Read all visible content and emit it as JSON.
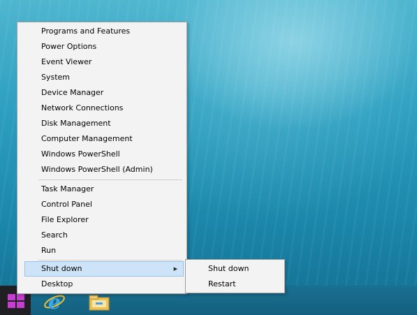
{
  "menu": {
    "items": [
      {
        "label": "Programs and Features"
      },
      {
        "label": "Power Options"
      },
      {
        "label": "Event Viewer"
      },
      {
        "label": "System"
      },
      {
        "label": "Device Manager"
      },
      {
        "label": "Network Connections"
      },
      {
        "label": "Disk Management"
      },
      {
        "label": "Computer Management"
      },
      {
        "label": "Windows PowerShell"
      },
      {
        "label": "Windows PowerShell (Admin)"
      },
      {
        "label": "Task Manager"
      },
      {
        "label": "Control Panel"
      },
      {
        "label": "File Explorer"
      },
      {
        "label": "Search"
      },
      {
        "label": "Run"
      },
      {
        "label": "Shut down"
      },
      {
        "label": "Desktop"
      }
    ]
  },
  "submenu": {
    "items": [
      {
        "label": "Shut down"
      },
      {
        "label": "Restart"
      }
    ]
  },
  "taskbar": {
    "icons": [
      "windows-start-icon",
      "internet-explorer-icon",
      "file-explorer-icon"
    ]
  },
  "colors": {
    "desktop": "#2d9fc0",
    "highlight": "#cde3f7",
    "start_logo": "#c63ed0"
  }
}
